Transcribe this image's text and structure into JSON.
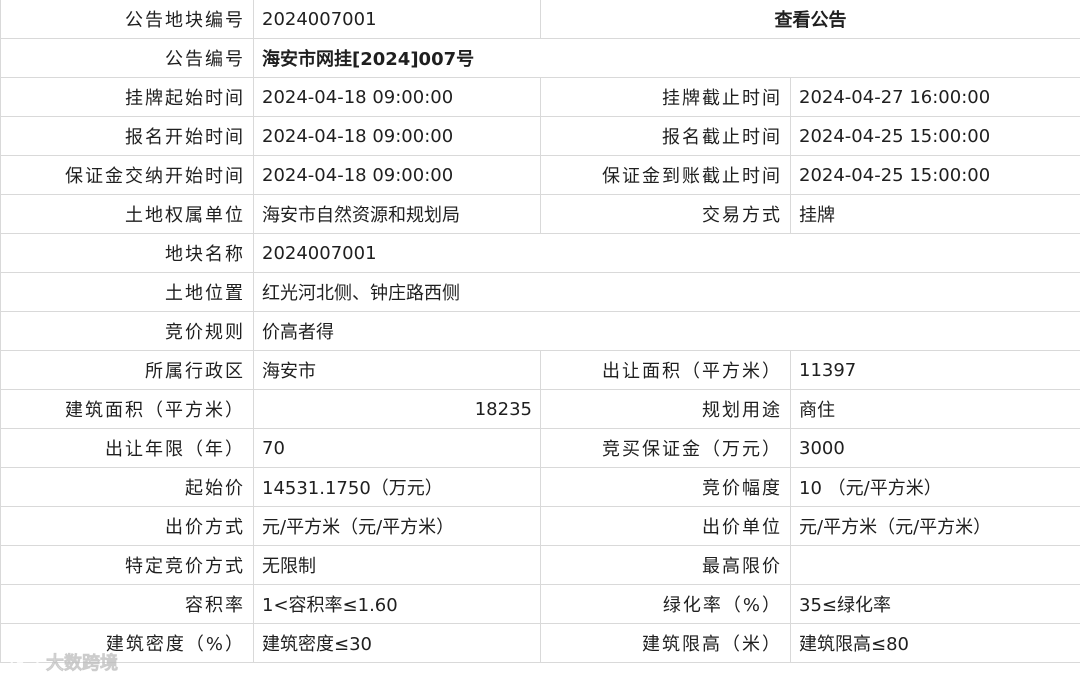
{
  "rows": {
    "r1": {
      "label": "公告地块编号",
      "value": "2024007001",
      "link": "查看公告"
    },
    "r2": {
      "label": "公告编号",
      "value": "海安市网挂[2024]007号"
    },
    "r3": {
      "label1": "挂牌起始时间",
      "value1": "2024-04-18 09:00:00",
      "label2": "挂牌截止时间",
      "value2": "2024-04-27 16:00:00"
    },
    "r4": {
      "label1": "报名开始时间",
      "value1": "2024-04-18 09:00:00",
      "label2": "报名截止时间",
      "value2": "2024-04-25 15:00:00"
    },
    "r5": {
      "label1": "保证金交纳开始时间",
      "value1": "2024-04-18 09:00:00",
      "label2": "保证金到账截止时间",
      "value2": "2024-04-25 15:00:00"
    },
    "r6": {
      "label1": "土地权属单位",
      "value1": "海安市自然资源和规划局",
      "label2": "交易方式",
      "value2": "挂牌"
    },
    "r7": {
      "label": "地块名称",
      "value": "2024007001"
    },
    "r8": {
      "label": "土地位置",
      "value": "红光河北侧、钟庄路西侧"
    },
    "r9": {
      "label": "竞价规则",
      "value": "价高者得"
    },
    "r10": {
      "label1": "所属行政区",
      "value1": "海安市",
      "label2": "出让面积（平方米）",
      "value2": "11397"
    },
    "r11": {
      "label1": "建筑面积（平方米）",
      "value1": "18235",
      "label2": "规划用途",
      "value2": "商住"
    },
    "r12": {
      "label1": "出让年限（年）",
      "value1": "70",
      "label2": "竞买保证金（万元）",
      "value2": "3000"
    },
    "r13": {
      "label1": "起始价",
      "value1": "14531.1750（万元）",
      "label2": "竞价幅度",
      "value2": "10 （元/平方米）"
    },
    "r14": {
      "label1": "出价方式",
      "value1": "元/平方米（元/平方米）",
      "label2": "出价单位",
      "value2": "元/平方米（元/平方米）"
    },
    "r15": {
      "label1": "特定竞价方式",
      "value1": "无限制",
      "label2": "最高限价",
      "value2": ""
    },
    "r16": {
      "label1": "容积率",
      "value1": "1<容积率≤1.60",
      "label2": "绿化率（%）",
      "value2": "35≤绿化率"
    },
    "r17": {
      "label1": "建筑密度（%）",
      "value1": "建筑密度≤30",
      "label2": "建筑限高（米）",
      "value2": "建筑限高≤80"
    }
  },
  "watermark": {
    "text": "大数跨境",
    "icon": "brand-logo-icon",
    "color": "#ffffff"
  },
  "colors": {
    "label": "#2e7d32",
    "border": "#d9d9d9",
    "text": "#1f1f1f"
  }
}
